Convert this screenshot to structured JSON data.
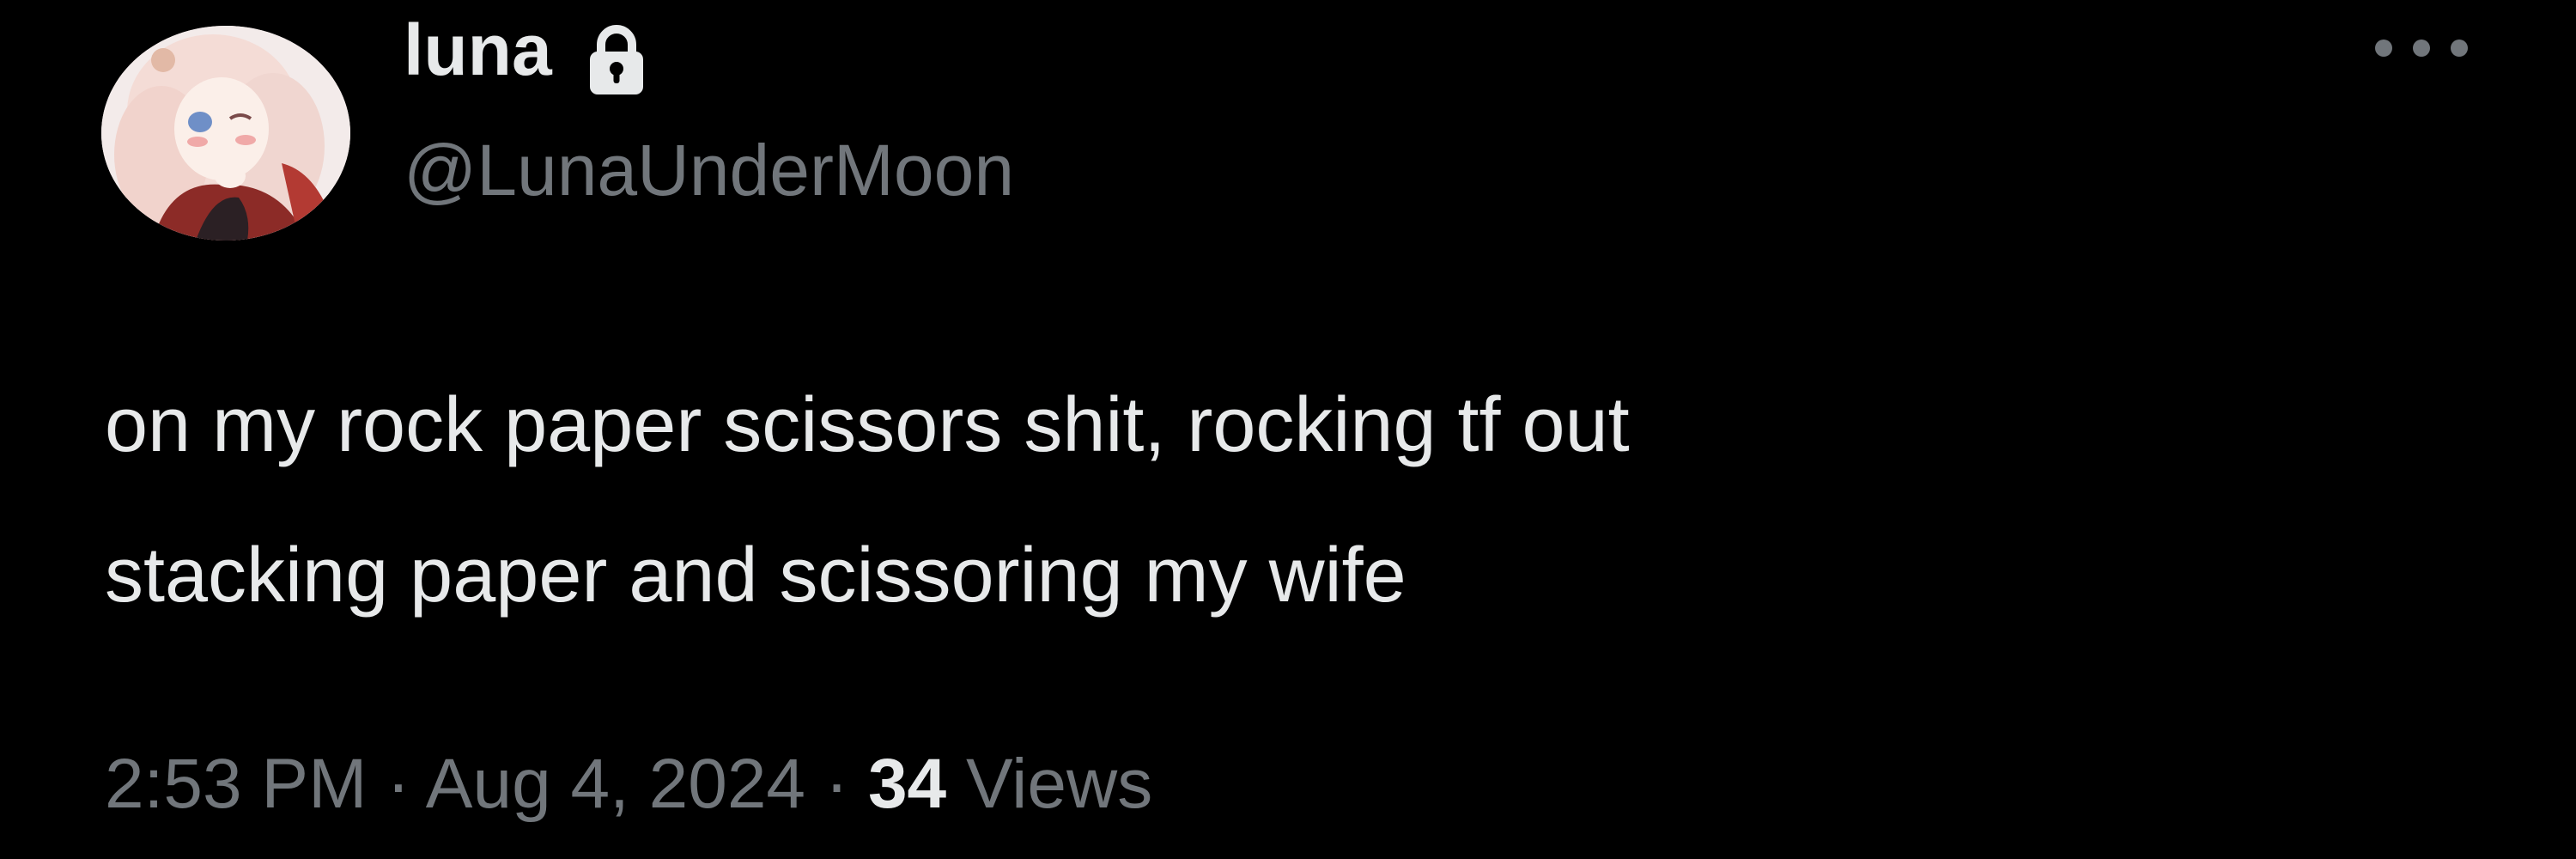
{
  "tweet": {
    "display_name": "luna",
    "handle": "@LunaUnderMoon",
    "protected_icon": "lock-icon",
    "more_icon": "more-horizontal-icon",
    "text_lines": [
      "on my rock paper scissors shit, rocking tf out",
      "stacking paper and scissoring my wife"
    ],
    "time": "2:53 PM",
    "separator": "·",
    "date": "Aug 4, 2024",
    "views_count": "34",
    "views_label": "Views"
  },
  "colors": {
    "background": "#000000",
    "primary_text": "#e7e9ea",
    "secondary_text": "#71767b"
  }
}
